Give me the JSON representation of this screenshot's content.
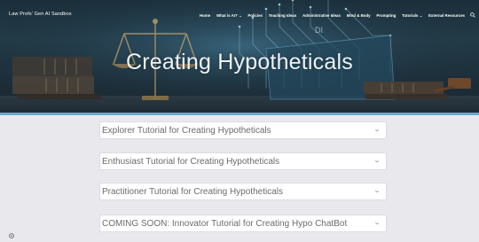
{
  "site": {
    "title": "Law Profs' Gen AI Sandbox"
  },
  "nav": {
    "items": [
      {
        "label": "Home",
        "has_dropdown": false
      },
      {
        "label": "What is AI?",
        "has_dropdown": true
      },
      {
        "label": "Policies",
        "has_dropdown": false
      },
      {
        "label": "Teaching Ideas",
        "has_dropdown": false
      },
      {
        "label": "Administrative Ideas",
        "has_dropdown": false
      },
      {
        "label": "Mind & Body",
        "has_dropdown": false
      },
      {
        "label": "Prompting",
        "has_dropdown": false
      },
      {
        "label": "Tutorials",
        "has_dropdown": true
      },
      {
        "label": "External Resources",
        "has_dropdown": false
      }
    ],
    "search_icon": "search-icon"
  },
  "hero": {
    "title": "Creating Hypotheticals",
    "art_label": "DI"
  },
  "accordions": [
    {
      "label": "Explorer Tutorial for Creating Hypotheticals"
    },
    {
      "label": "Enthusiast Tutorial for Creating Hypotheticals"
    },
    {
      "label": "Practitioner Tutorial for Creating Hypotheticals"
    },
    {
      "label": "COMING SOON: Innovator Tutorial for Creating Hypo ChatBot"
    }
  ],
  "colors": {
    "page_bg": "#e9e8ed",
    "hero_bg": "#1c2e39",
    "accent_strip": "#6fa8c9",
    "accordion_text": "#6b6b6b"
  }
}
